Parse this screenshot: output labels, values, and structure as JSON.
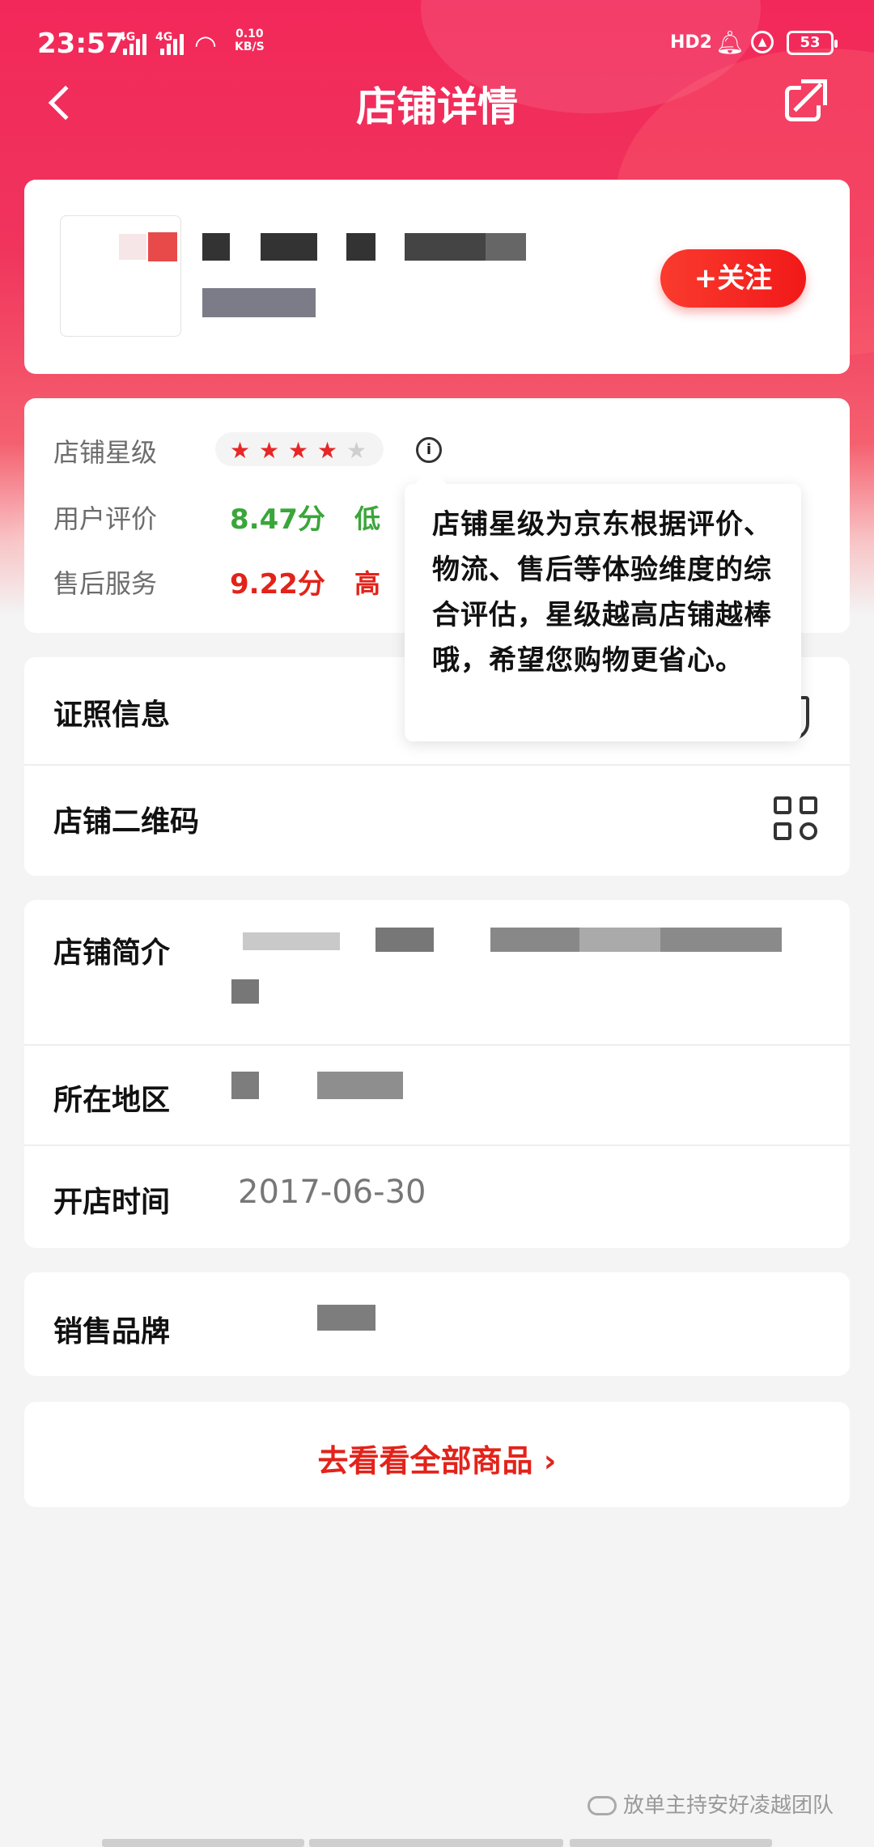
{
  "status_bar": {
    "time": "23:57",
    "net1": "4G",
    "net2": "4G",
    "speed_value": "0.10",
    "speed_unit": "KB/S",
    "hd": "HD2",
    "battery": "53"
  },
  "header": {
    "title": "店铺详情"
  },
  "shop": {
    "follow_label": "+关注"
  },
  "rating": {
    "stars_label": "店铺星级",
    "stars_value": 4,
    "stars_max": 5,
    "user_label": "用户评价",
    "user_score": "8.47分",
    "user_level": "低",
    "service_label": "售后服务",
    "service_score": "9.22分",
    "service_level": "高",
    "user_color": "#3aa63a",
    "service_color": "#e2231a"
  },
  "tooltip": {
    "text": "店铺星级为京东根据评价、物流、售后等体验维度的综合评估，星级越高店铺越棒哦，希望您购物更省心。"
  },
  "rows": {
    "license_label": "证照信息",
    "qrcode_label": "店铺二维码",
    "intro_label": "店铺简介",
    "region_label": "所在地区",
    "open_label": "开店时间",
    "open_value": "2017-06-30",
    "brand_label": "销售品牌"
  },
  "cta": {
    "label": "去看看全部商品 ›"
  },
  "watermark": {
    "text": "放单主持安好凌越团队"
  },
  "colors": {
    "accent": "#e2231a",
    "header_gradient_top": "#f2285a"
  }
}
